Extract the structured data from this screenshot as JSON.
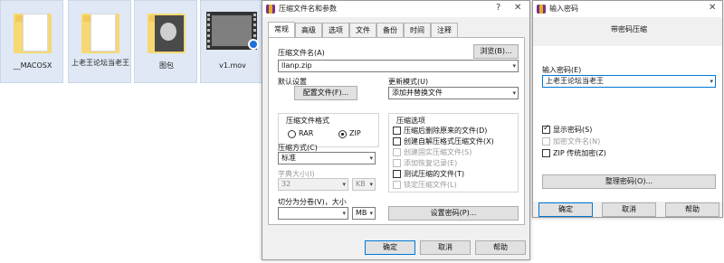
{
  "explorer": {
    "files": [
      {
        "name": "__MACOSX",
        "icon": "folder-icon"
      },
      {
        "name": "上老王论坛当老王",
        "icon": "folder-icon"
      },
      {
        "name": "图包",
        "icon": "image-folder-icon"
      },
      {
        "name": "v1.mov",
        "icon": "video-file-icon"
      }
    ]
  },
  "archive_dialog": {
    "title": "压缩文件名和参数",
    "help_glyph": "?",
    "close_glyph": "✕",
    "tabs": [
      "常规",
      "高级",
      "选项",
      "文件",
      "备份",
      "时间",
      "注释"
    ],
    "archive_name_label": "压缩文件名(A)",
    "archive_name_value": "llanp.zip",
    "browse_label": "浏览(B)...",
    "default_settings_label": "默认设置",
    "profiles_button": "配置文件(F)...",
    "update_mode_label": "更新模式(U)",
    "update_mode_value": "添加并替换文件",
    "format_group_label": "压缩文件格式",
    "formats": [
      "RAR",
      "ZIP"
    ],
    "selected_format": "ZIP",
    "options_group_label": "压缩选项",
    "options": [
      {
        "label": "压缩后删除原来的文件(D)",
        "checked": false,
        "enabled": true
      },
      {
        "label": "创建自解压格式压缩文件(X)",
        "checked": false,
        "enabled": true
      },
      {
        "label": "创建固实压缩文件(S)",
        "checked": false,
        "enabled": false
      },
      {
        "label": "添加恢复记录(E)",
        "checked": false,
        "enabled": false
      },
      {
        "label": "测试压缩的文件(T)",
        "checked": false,
        "enabled": true
      },
      {
        "label": "锁定压缩文件(L)",
        "checked": false,
        "enabled": false
      }
    ],
    "method_label": "压缩方式(C)",
    "method_value": "标准",
    "dict_size_label": "字典大小(I)",
    "dict_size_value": "32",
    "dict_unit": "KB",
    "split_label": "切分为分卷(V)，大小",
    "split_value": "",
    "split_unit": "MB",
    "set_password_button": "设置密码(P)...",
    "ok_button": "确定",
    "cancel_button": "取消",
    "help_button": "帮助"
  },
  "password_dialog": {
    "title": "输入密码",
    "close_glyph": "✕",
    "heading": "带密码压缩",
    "password_label": "输入密码(E)",
    "password_value": "上老王论坛当老王",
    "show_password_label": "显示密码(S)",
    "show_password_checked": true,
    "encrypt_names_label": "加密文件名(N)",
    "encrypt_names_checked": false,
    "zip_legacy_label": "ZIP 传统加密(Z)",
    "zip_legacy_checked": false,
    "organize_button": "整理密码(O)...",
    "ok_button": "确定",
    "cancel_button": "取消",
    "help_button": "帮助"
  }
}
